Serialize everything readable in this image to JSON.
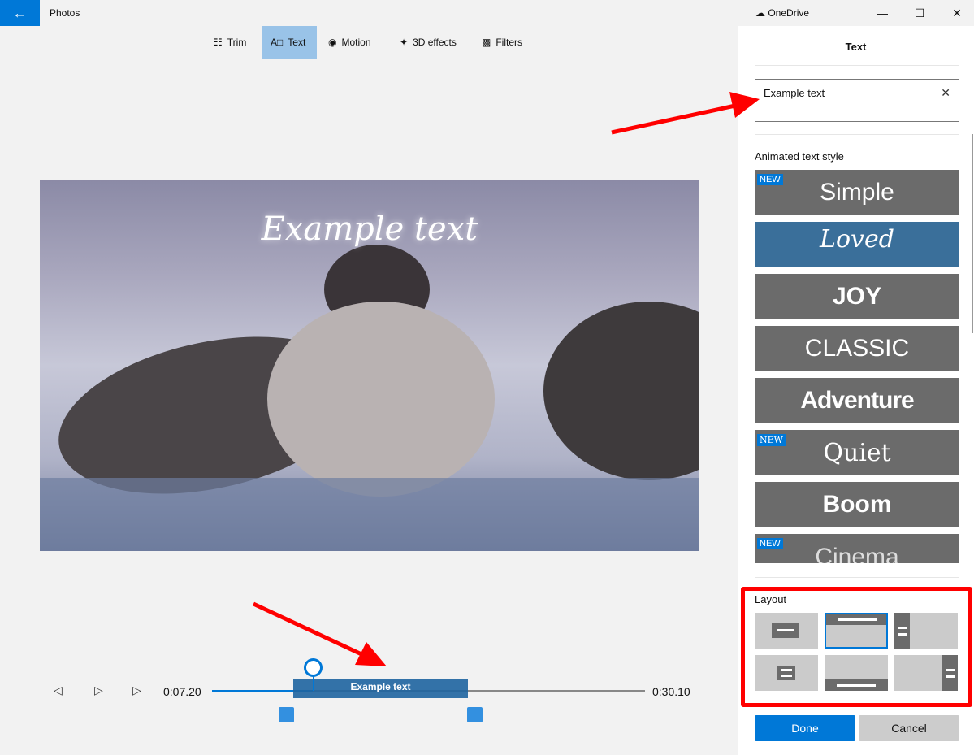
{
  "app": {
    "title": "Photos",
    "back_icon": "arrow-left-icon",
    "onedrive": "OneDrive"
  },
  "toolbar": [
    {
      "label": "Trim",
      "icon": "trim-icon"
    },
    {
      "label": "Text",
      "icon": "text-icon",
      "active": true
    },
    {
      "label": "Motion",
      "icon": "motion-icon"
    },
    {
      "label": "3D effects",
      "icon": "3d-effects-icon"
    },
    {
      "label": "Filters",
      "icon": "filters-icon"
    }
  ],
  "video": {
    "overlay_text": "Example text"
  },
  "panel": {
    "title": "Text",
    "text_value": "Example text",
    "style_label": "Animated text style",
    "styles": [
      {
        "name": "Simple",
        "new": true
      },
      {
        "name": "Loved",
        "selected": true
      },
      {
        "name": "JOY"
      },
      {
        "name": "CLASSIC"
      },
      {
        "name": "Adventure"
      },
      {
        "name": "Quiet",
        "new": true
      },
      {
        "name": "Boom"
      },
      {
        "name": "Cinema",
        "new": true
      }
    ],
    "new_badge": "NEW",
    "layout_label": "Layout",
    "selected_layout": "top",
    "done": "Done",
    "cancel": "Cancel"
  },
  "timeline": {
    "current": "0:07.20",
    "total": "0:30.10",
    "clip_label": "Example text",
    "progress_fraction": 0.23
  },
  "colors": {
    "accent": "#0078d7",
    "selected_style": "#3a6f9a",
    "annotation": "#ff0000"
  }
}
